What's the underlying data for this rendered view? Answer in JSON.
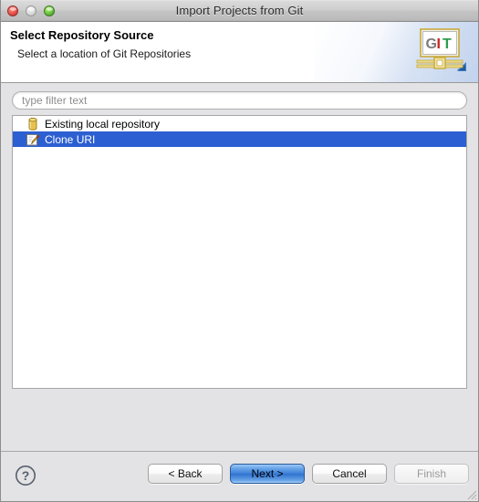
{
  "window": {
    "title": "Import Projects from Git",
    "controls": [
      {
        "name": "close",
        "label": "Close"
      },
      {
        "name": "minimize",
        "label": "Minimize"
      },
      {
        "name": "zoom",
        "label": "Zoom"
      }
    ]
  },
  "header": {
    "title": "Select Repository Source",
    "subtitle": "Select a location of Git Repositories",
    "logo": {
      "name": "git-banner-icon",
      "letters": [
        "G",
        "I",
        "T"
      ],
      "letter_colors": [
        "#7c7c7c",
        "#c8241c",
        "#2e9c4f"
      ],
      "frame_color": "#c8a93a",
      "arrow_color": "#2f6fb5"
    }
  },
  "filter": {
    "placeholder": "type filter text",
    "value": ""
  },
  "list": {
    "items": [
      {
        "label": "Existing local repository",
        "icon": "repository-icon",
        "selected": false
      },
      {
        "label": "Clone URI",
        "icon": "clone-uri-icon",
        "selected": true
      }
    ],
    "selection_color": "#2c5fd1"
  },
  "footer": {
    "help_label": "?",
    "buttons": [
      {
        "name": "back",
        "label": "< Back",
        "state": "enabled"
      },
      {
        "name": "next",
        "label": "Next >",
        "state": "default"
      },
      {
        "name": "cancel",
        "label": "Cancel",
        "state": "enabled"
      },
      {
        "name": "finish",
        "label": "Finish",
        "state": "disabled"
      }
    ]
  }
}
